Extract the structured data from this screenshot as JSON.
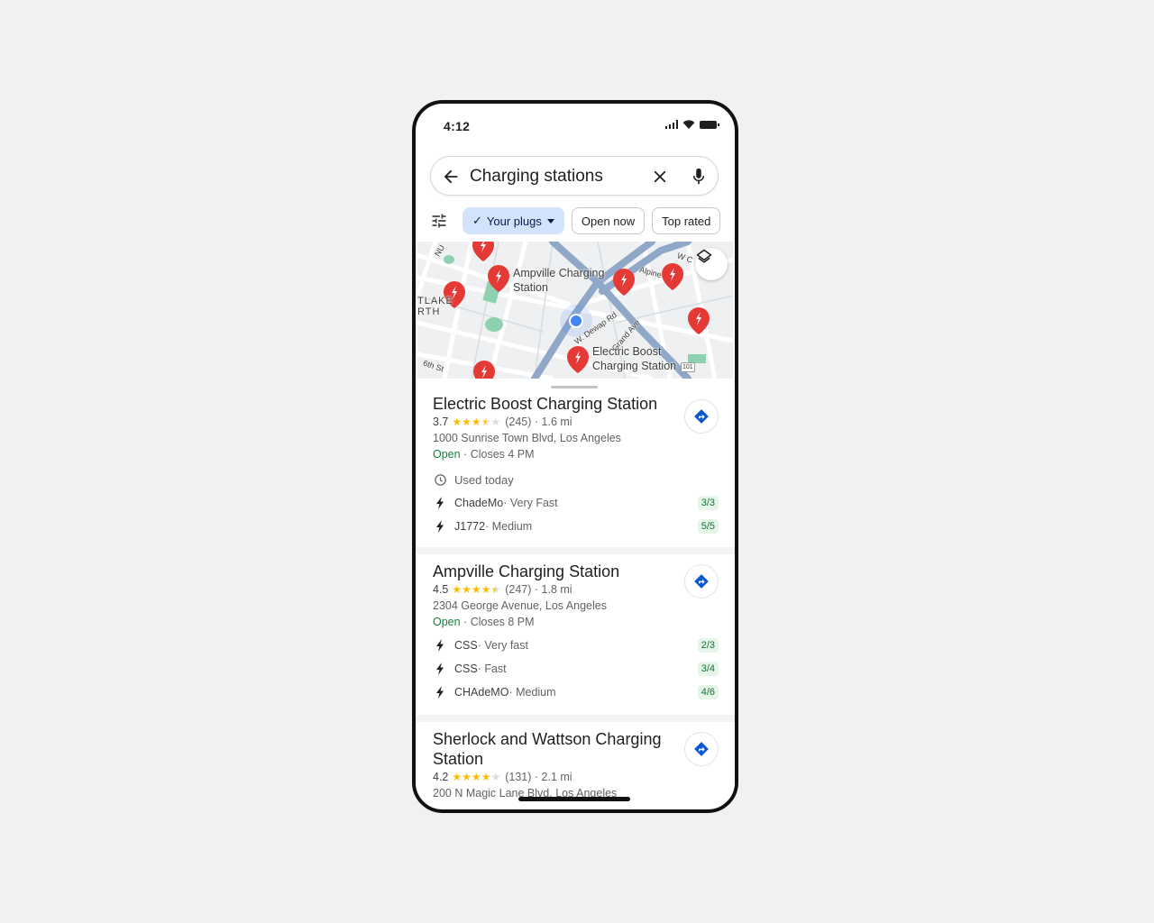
{
  "status_bar": {
    "time": "4:12"
  },
  "search": {
    "query": "Charging stations",
    "back_icon": "arrow-left-icon",
    "clear_icon": "close-icon",
    "mic_icon": "microphone-icon"
  },
  "filters": {
    "filter_icon": "tune-icon",
    "chips": [
      {
        "label": "Your plugs",
        "active": true,
        "dropdown": true,
        "check": "✓"
      },
      {
        "label": "Open now",
        "active": false
      },
      {
        "label": "Top rated",
        "active": false
      }
    ]
  },
  "map": {
    "labels": {
      "ampville": "Ampville Charging Station",
      "electric": "Electric Boost Charging Station",
      "lake": "TLAKE\nRTH",
      "sixth": "6th St",
      "dewap": "W. Dewap Rd",
      "grand": "Grand Ave",
      "alpine": "Alpine",
      "wc": "W C",
      "nu": "NU",
      "hwy": "101"
    },
    "layers_icon": "layers-icon",
    "colors": {
      "pin": "#e53935",
      "road": "#8fa8c8",
      "park": "#8ed1b0",
      "location": "#4285f4"
    }
  },
  "results": [
    {
      "name": "Electric Boost Charging Station",
      "rating": "3.7",
      "stars": 3.7,
      "reviews": "(245)",
      "distance": "· 1.6 mi",
      "address": "1000 Sunrise Town Blvd, Los Angeles",
      "open": "Open",
      "closes": " · Closes 4 PM",
      "used": "Used today",
      "plugs": [
        {
          "type": "ChadeMo",
          "speed": " · Very Fast",
          "available": "3/3"
        },
        {
          "type": "J1772",
          "speed": " · Medium",
          "available": "5/5"
        }
      ]
    },
    {
      "name": "Ampville Charging Station",
      "rating": "4.5",
      "stars": 4.5,
      "reviews": "(247)",
      "distance": "· 1.8 mi",
      "address": "2304 George Avenue, Los Angeles",
      "open": "Open",
      "closes": " · Closes 8 PM",
      "plugs": [
        {
          "type": "CSS",
          "speed": " · Very fast",
          "available": "2/3"
        },
        {
          "type": "CSS",
          "speed": " · Fast",
          "available": "3/4"
        },
        {
          "type": "CHAdeMO",
          "speed": " · Medium",
          "available": "4/6"
        }
      ]
    },
    {
      "name": "Sherlock and Wattson Charging Station",
      "rating": "4.2",
      "stars": 4.2,
      "reviews": "(131)",
      "distance": "· 2.1 mi",
      "address": "200 N Magic Lane Blvd, Los Angeles"
    }
  ],
  "colors": {
    "star": "#fbbc04",
    "star_empty": "#dadce0",
    "accent": "#0b57d0",
    "open": "#188038"
  }
}
